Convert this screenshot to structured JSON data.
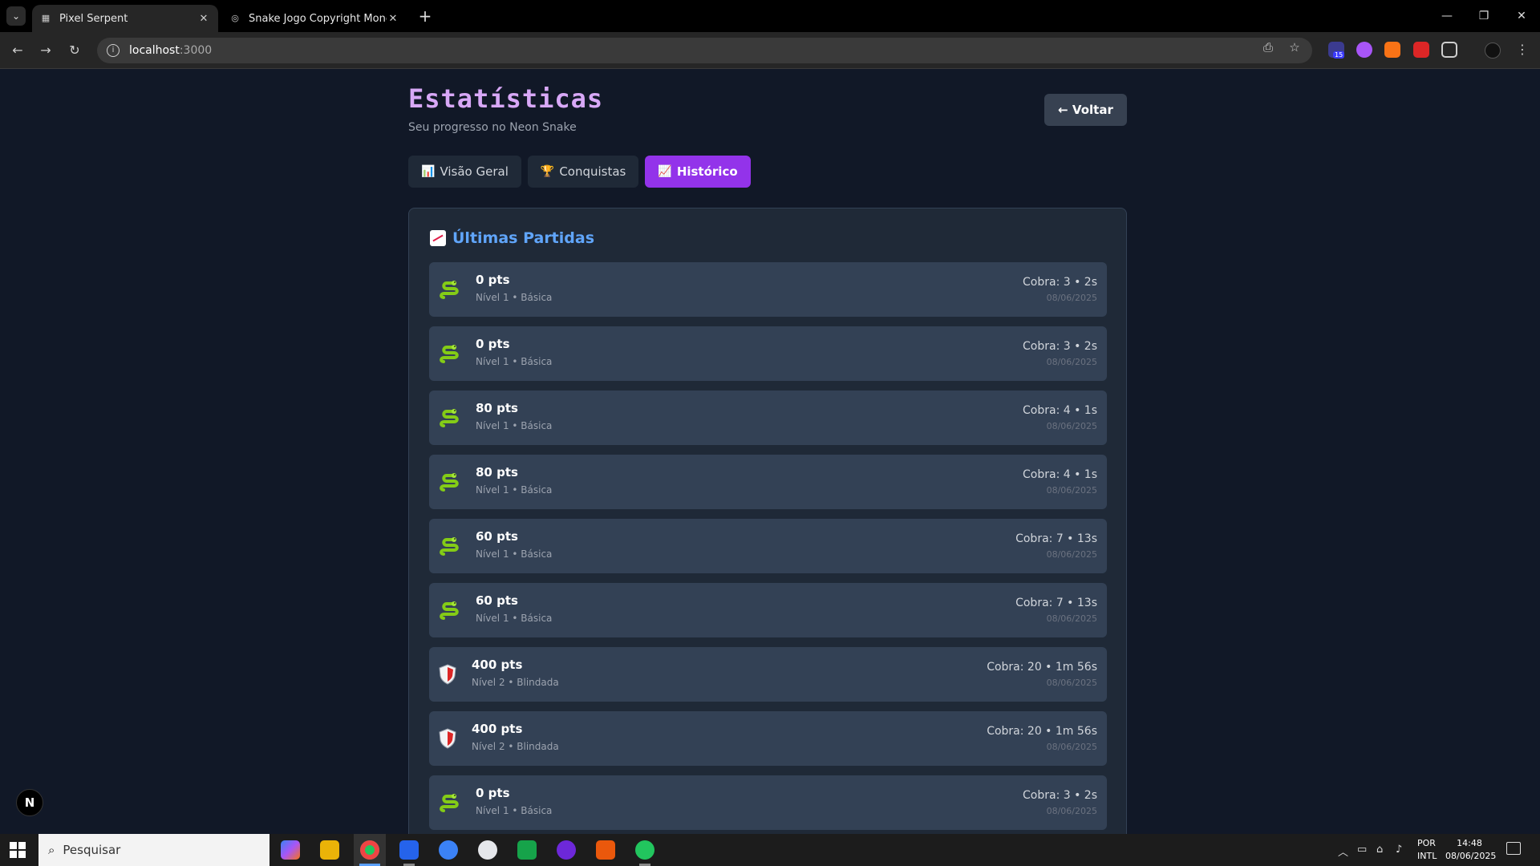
{
  "browser": {
    "tabs": [
      {
        "title": "Pixel Serpent",
        "active": true
      },
      {
        "title": "Snake Jogo Copyright Monetiza",
        "active": false
      }
    ],
    "url_host": "localhost",
    "url_port": ":3000"
  },
  "page": {
    "title": "Estatísticas",
    "subtitle": "Seu progresso no Neon Snake",
    "back_label": "← Voltar",
    "tabs": [
      {
        "icon": "📊",
        "label": "Visão Geral",
        "active": false
      },
      {
        "icon": "🏆",
        "label": "Conquistas",
        "active": false
      },
      {
        "icon": "📈",
        "label": "Histórico",
        "active": true
      }
    ],
    "section_title": "Últimas Partidas",
    "games": [
      {
        "icon": "snake",
        "score": "0 pts",
        "level": "Nível 1 • Básica",
        "stats": "Cobra: 3 • 2s",
        "date": "08/06/2025"
      },
      {
        "icon": "snake",
        "score": "0 pts",
        "level": "Nível 1 • Básica",
        "stats": "Cobra: 3 • 2s",
        "date": "08/06/2025"
      },
      {
        "icon": "snake",
        "score": "80 pts",
        "level": "Nível 1 • Básica",
        "stats": "Cobra: 4 • 1s",
        "date": "08/06/2025"
      },
      {
        "icon": "snake",
        "score": "80 pts",
        "level": "Nível 1 • Básica",
        "stats": "Cobra: 4 • 1s",
        "date": "08/06/2025"
      },
      {
        "icon": "snake",
        "score": "60 pts",
        "level": "Nível 1 • Básica",
        "stats": "Cobra: 7 • 13s",
        "date": "08/06/2025"
      },
      {
        "icon": "snake",
        "score": "60 pts",
        "level": "Nível 1 • Básica",
        "stats": "Cobra: 7 • 13s",
        "date": "08/06/2025"
      },
      {
        "icon": "shield",
        "score": "400 pts",
        "level": "Nível 2 • Blindada",
        "stats": "Cobra: 20 • 1m 56s",
        "date": "08/06/2025"
      },
      {
        "icon": "shield",
        "score": "400 pts",
        "level": "Nível 2 • Blindada",
        "stats": "Cobra: 20 • 1m 56s",
        "date": "08/06/2025"
      },
      {
        "icon": "snake",
        "score": "0 pts",
        "level": "Nível 1 • Básica",
        "stats": "Cobra: 3 • 2s",
        "date": "08/06/2025"
      }
    ],
    "dev_badge": "N"
  },
  "taskbar": {
    "search_placeholder": "Pesquisar",
    "lang_line1": "POR",
    "lang_line2": "INTL",
    "time": "14:48",
    "date": "08/06/2025"
  },
  "colors": {
    "title": "#d8a8f7",
    "active_tab": "#9333ea",
    "section_title": "#60a5fa",
    "page_bg": "#111827"
  }
}
